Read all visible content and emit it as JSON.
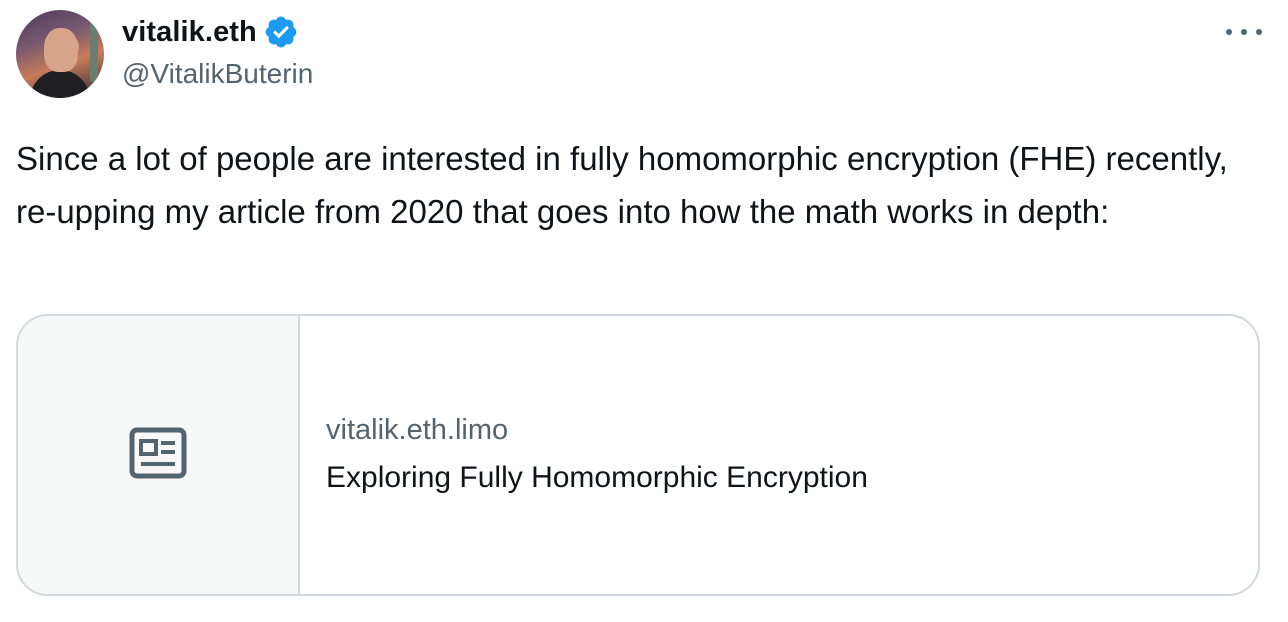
{
  "author": {
    "display_name": "vitalik.eth",
    "handle": "@VitalikButerin",
    "verified": true,
    "verified_color": "#1d9bf0"
  },
  "tweet": {
    "text": "Since a lot of people are interested in fully homomorphic encryption (FHE) recently, re-upping my article from 2020 that goes into how the math works in depth:"
  },
  "link_card": {
    "domain": "vitalik.eth.limo",
    "title": "Exploring Fully Homomorphic Encryption",
    "thumbnail_icon": "newspaper-icon"
  },
  "menu": {
    "icon": "more-options-icon"
  },
  "colors": {
    "text_primary": "#0f1419",
    "text_secondary": "#536471",
    "border": "#cfd9de"
  }
}
